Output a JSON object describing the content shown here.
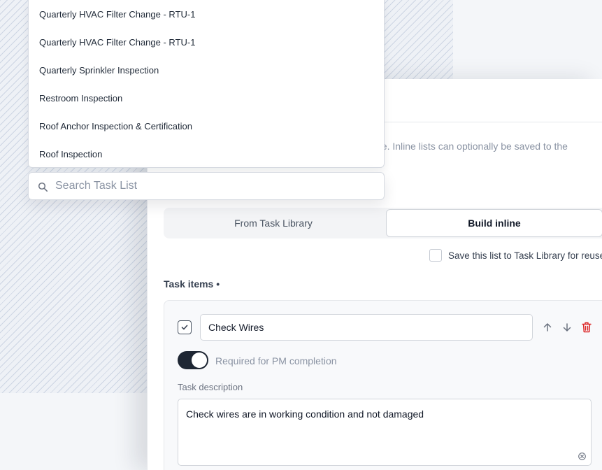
{
  "task_list_dropdown": {
    "items": [
      {
        "label": "Quarterly HVAC Filter Change - RTU-1"
      },
      {
        "label": "Quarterly HVAC Filter Change - RTU-1"
      },
      {
        "label": "Quarterly Sprinkler Inspection"
      },
      {
        "label": "Restroom Inspection"
      },
      {
        "label": "Roof Anchor Inspection & Certification"
      },
      {
        "label": "Roof Inspection"
      }
    ],
    "search_placeholder": "Search Task List"
  },
  "panel": {
    "description_fragment": "ne. Inline lists can optionally be saved to the",
    "source_tabs": [
      {
        "label": "From Task Library",
        "selected": false
      },
      {
        "label": "Build inline",
        "selected": true
      }
    ],
    "save_to_library_label": "Save this list to Task Library for reuse",
    "save_to_library_checked": false,
    "task_items_label": "Task items •",
    "task": {
      "checked": true,
      "name": "Check Wires",
      "required_label": "Required for PM completion",
      "required_enabled": true,
      "description_label": "Task description",
      "description": "Check wires are in working condition and not damaged"
    }
  },
  "colors": {
    "toggle_on": "#1e2633",
    "delete_icon": "#dc2626",
    "muted_text": "#8a93a3"
  }
}
